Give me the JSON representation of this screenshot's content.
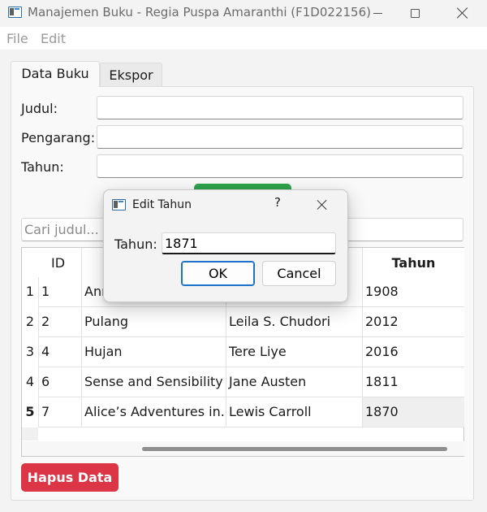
{
  "window": {
    "title": "Manajemen Buku - Regia Puspa Amaranthi (F1D022156)"
  },
  "menu": {
    "file": "File",
    "edit": "Edit"
  },
  "tabs": [
    {
      "label": "Data Buku"
    },
    {
      "label": "Ekspor"
    }
  ],
  "form": {
    "judul_label": "Judul:",
    "judul_value": "",
    "pengarang_label": "Pengarang:",
    "pengarang_value": "",
    "tahun_label": "Tahun:",
    "tahun_value": ""
  },
  "search": {
    "placeholder": "Cari judul..."
  },
  "table": {
    "headers": [
      "ID",
      "",
      "",
      "Tahun"
    ],
    "rows": [
      {
        "row_header": "1",
        "id": "1",
        "judul": "Ann",
        "pengarang": "",
        "tahun": "1908"
      },
      {
        "row_header": "2",
        "id": "2",
        "judul": "Pulang",
        "pengarang": "Leila S. Chudori",
        "tahun": "2012"
      },
      {
        "row_header": "3",
        "id": "4",
        "judul": "Hujan",
        "pengarang": "Tere Liye",
        "tahun": "2016"
      },
      {
        "row_header": "4",
        "id": "6",
        "judul": "Sense and Sensibility",
        "pengarang": "Jane Austen",
        "tahun": "1811"
      },
      {
        "row_header": "5",
        "id": "7",
        "judul": "Alice’s Adventures in...",
        "pengarang": "Lewis Carroll",
        "tahun": "1870"
      }
    ]
  },
  "buttons": {
    "delete": "Hapus Data",
    "green_button_label": ""
  },
  "dialog": {
    "title": "Edit Tahun",
    "help": "?",
    "label": "Tahun:",
    "value": "1871",
    "ok": "OK",
    "cancel": "Cancel"
  },
  "colors": {
    "accent_green": "#2da24b",
    "danger_red": "#dc3545",
    "focus_blue": "#1a73c8"
  }
}
